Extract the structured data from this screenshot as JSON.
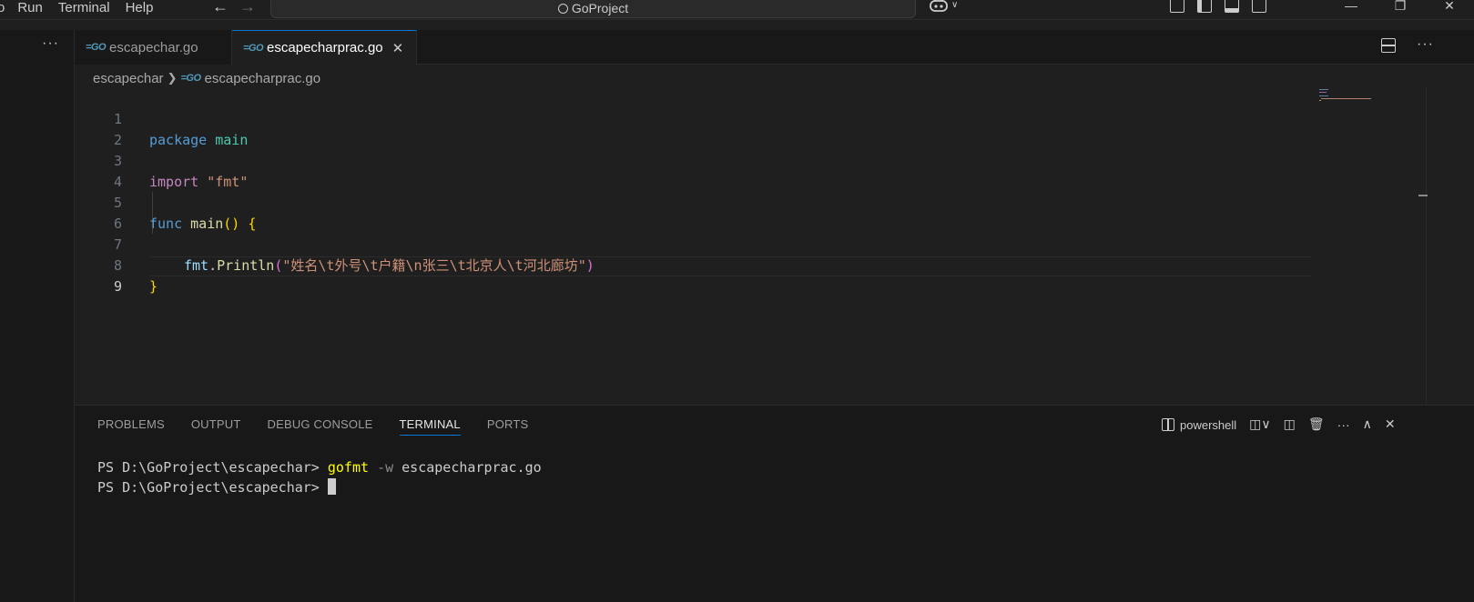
{
  "menu": {
    "items": [
      "o",
      "Run",
      "Terminal",
      "Help"
    ]
  },
  "titlebar": {
    "search_text": "GoProject"
  },
  "tabs": [
    {
      "label": "escapechar.go",
      "active": false
    },
    {
      "label": "escapecharprac.go",
      "active": true
    }
  ],
  "breadcrumb": {
    "folder": "escapechar",
    "file": "escapecharprac.go"
  },
  "editor": {
    "lines": [
      {
        "n": "1",
        "text": "package main"
      },
      {
        "n": "2",
        "text": ""
      },
      {
        "n": "3",
        "text": "import \"fmt\""
      },
      {
        "n": "4",
        "text": ""
      },
      {
        "n": "5",
        "text": "func main() {"
      },
      {
        "n": "6",
        "text": ""
      },
      {
        "n": "7",
        "text": "    fmt.Println(\"姓名\\t外号\\t户籍\\n张三\\t北京人\\t河北廊坊\")"
      },
      {
        "n": "8",
        "text": "}"
      },
      {
        "n": "9",
        "text": ""
      }
    ],
    "tokens": {
      "package": "package",
      "main": "main",
      "import": "import",
      "fmt_str": "\"fmt\"",
      "func": "func",
      "main_fn": "main",
      "parens": "()",
      "lbrace": "{",
      "fmt": "fmt",
      "dot": ".",
      "println": "Println",
      "lparen": "(",
      "string": "\"姓名\\t外号\\t户籍\\n张三\\t北京人\\t河北廊坊\"",
      "rparen": ")",
      "rbrace": "}"
    },
    "active_line": "9"
  },
  "panel": {
    "tabs": [
      "PROBLEMS",
      "OUTPUT",
      "DEBUG CONSOLE",
      "TERMINAL",
      "PORTS"
    ],
    "active_tab": "TERMINAL",
    "terminal_label": "powershell",
    "terminal_lines": [
      {
        "prompt": "PS D:\\GoProject\\escapechar> ",
        "cmd": "gofmt",
        "flag": "-w",
        "arg": "escapecharprac.go"
      },
      {
        "prompt": "PS D:\\GoProject\\escapechar> "
      }
    ]
  },
  "icons": {
    "back": "arrow-left-icon",
    "forward": "arrow-right-icon",
    "search": "search-icon",
    "copilot": "copilot-icon",
    "close": "close-icon",
    "split": "split-editor-icon",
    "more": "more-actions-icon",
    "trash": "trash-icon",
    "maximize": "chevron-up-icon"
  },
  "colors": {
    "accent": "#0078d4",
    "keyword": "#569cd6",
    "string": "#ce9178",
    "type": "#4ec9b0"
  }
}
